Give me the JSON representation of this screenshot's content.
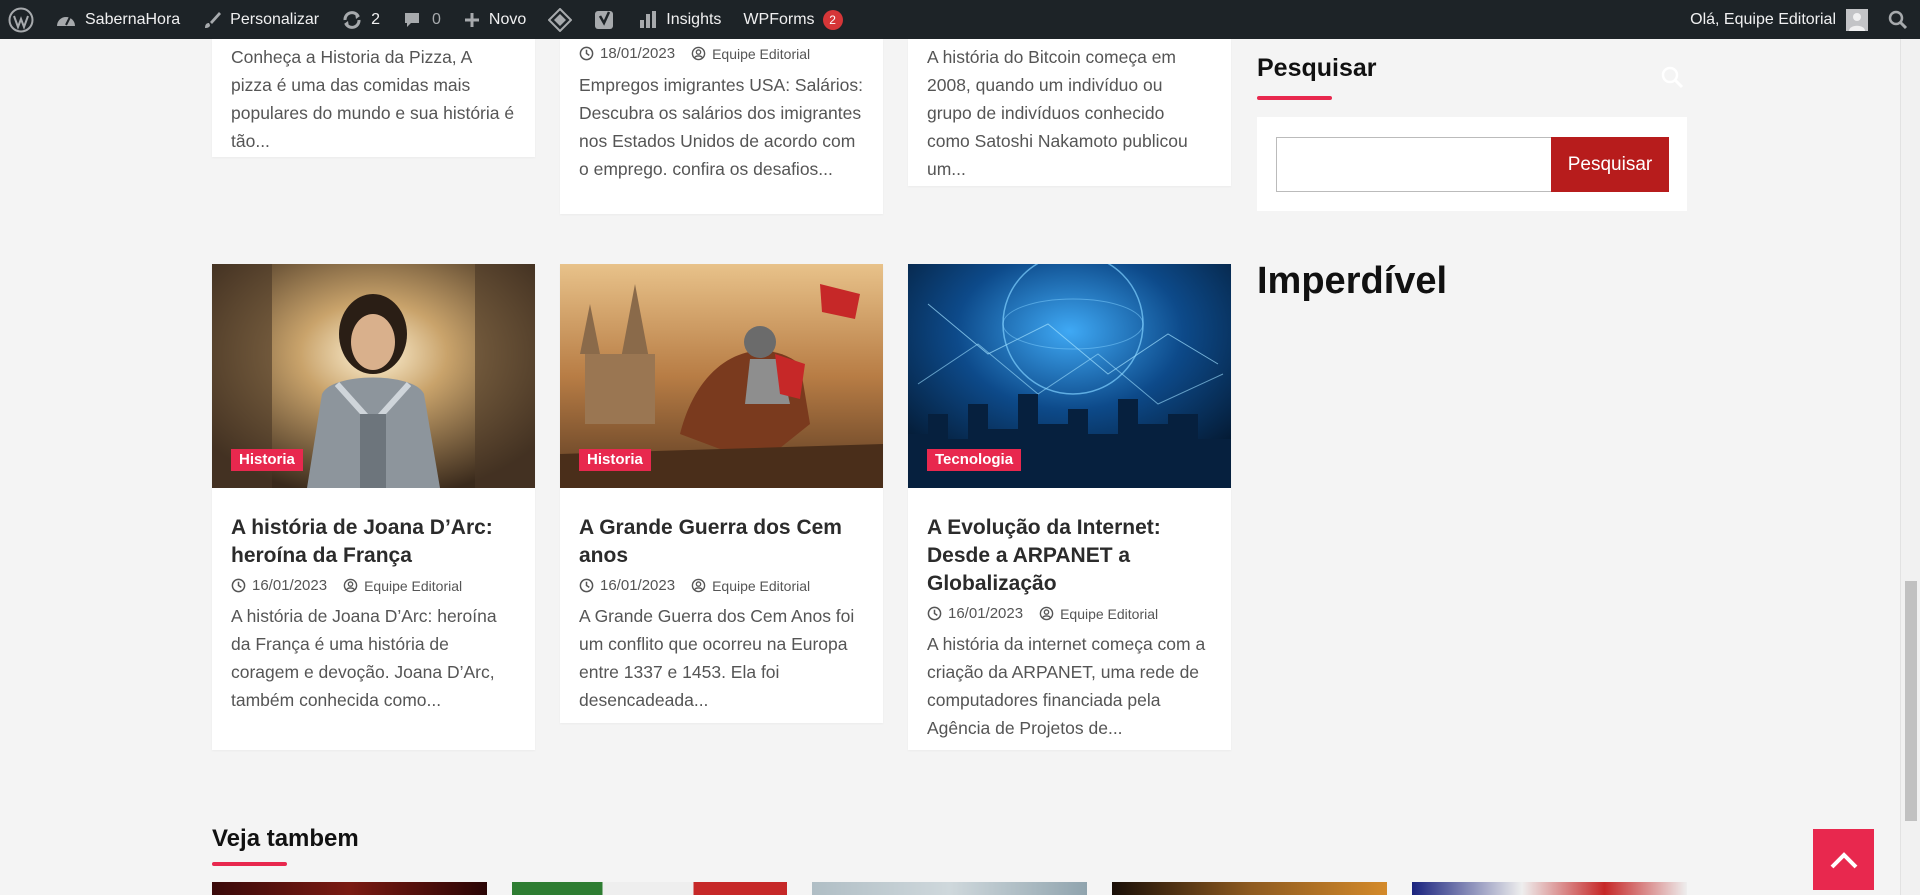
{
  "adminbar": {
    "site_name": "SabernaHora",
    "customize": "Personalizar",
    "updates_count": "2",
    "comments_count": "0",
    "new": "Novo",
    "insights": "Insights",
    "wpforms": "WPForms",
    "wpforms_badge": "2",
    "greeting": "Olá, Equipe Editorial"
  },
  "top_cards": [
    {
      "text": "Conheça a Historia da Pizza, A pizza é uma das comidas mais populares do mundo e sua história é tão..."
    },
    {
      "date": "18/01/2023",
      "author": "Equipe Editorial",
      "text": "Empregos imigrantes USA: Salários: Descubra os salários dos imigrantes nos Estados Unidos de acordo com o emprego. confira os desafios..."
    },
    {
      "text": "A história do Bitcoin começa em 2008, quando um indivíduo ou grupo de indivíduos conhecido como Satoshi Nakamoto publicou um..."
    }
  ],
  "cards": [
    {
      "category": "Historia",
      "title": "A história de Joana D’Arc: heroína da França",
      "date": "16/01/2023",
      "author": "Equipe Editorial",
      "text": "A história de Joana D’Arc: heroína da França é uma história de coragem e devoção. Joana D’Arc, também conhecida como..."
    },
    {
      "category": "Historia",
      "title": "A Grande Guerra dos Cem anos",
      "date": "16/01/2023",
      "author": "Equipe Editorial",
      "text": "A Grande Guerra dos Cem Anos foi um conflito que ocorreu na Europa entre 1337 e 1453. Ela foi desencadeada..."
    },
    {
      "category": "Tecnologia",
      "title": "A Evolução da Internet: Desde a ARPANET a Globalização",
      "date": "16/01/2023",
      "author": "Equipe Editorial",
      "text": "A história da internet começa com a criação da ARPANET, uma rede de computadores financiada pela Agência de Projetos de..."
    }
  ],
  "sidebar": {
    "search_title": "Pesquisar",
    "search_button": "Pesquisar",
    "search_value": "",
    "imperdivel_title": "Imperdível"
  },
  "related": {
    "title": "Veja tambem"
  },
  "colors": {
    "accent": "#e8284e",
    "button": "#b71c1c",
    "adminbar": "#1d2327"
  }
}
